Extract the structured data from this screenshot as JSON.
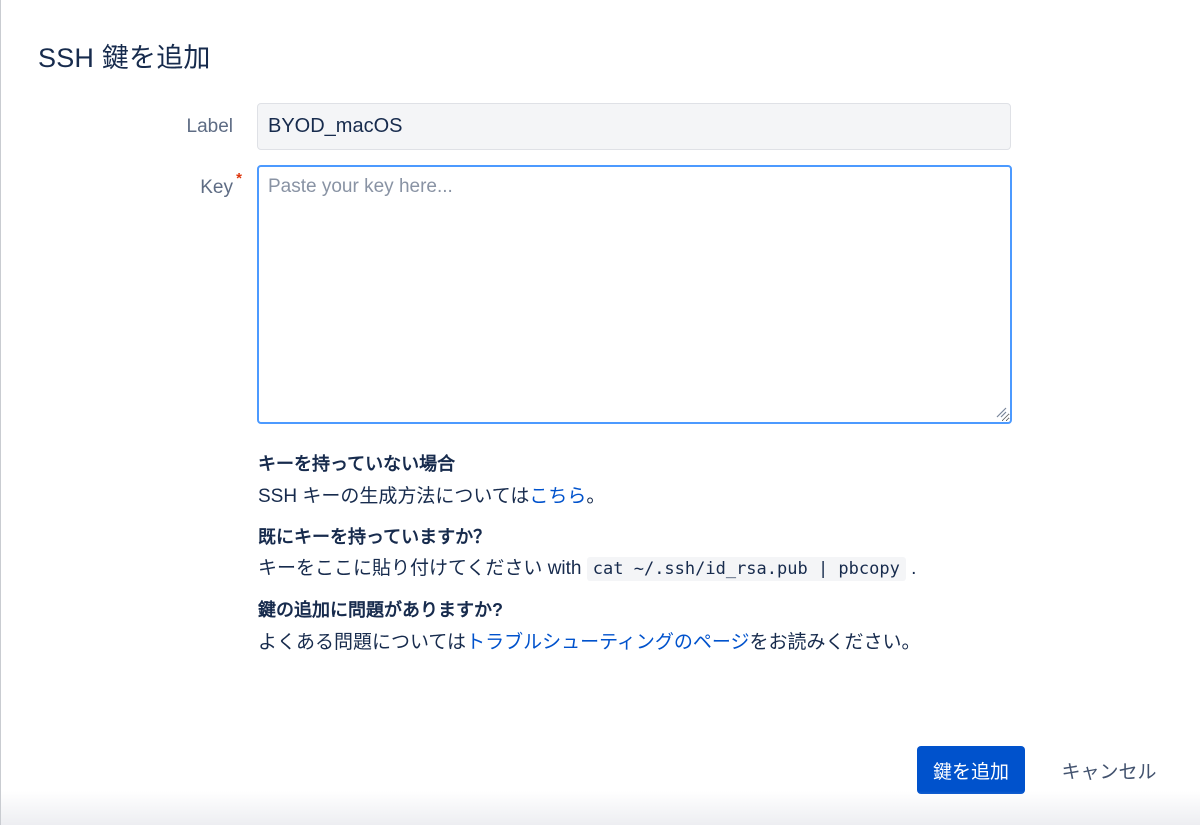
{
  "dialog": {
    "title": "SSH 鍵を追加"
  },
  "form": {
    "label_field": {
      "label": "Label",
      "value": "BYOD_macOS"
    },
    "key_field": {
      "label": "Key",
      "required_marker": "*",
      "placeholder": "Paste your key here...",
      "value": ""
    }
  },
  "help": {
    "no_key": {
      "heading": "キーを持っていない場合",
      "text_before": "SSH キーの生成方法については",
      "link": "こちら",
      "text_after": "。"
    },
    "have_key": {
      "heading": "既にキーを持っていますか？",
      "text_before": "キーをここに貼り付けてください with ",
      "command": "cat ~/.ssh/id_rsa.pub | pbcopy",
      "text_after": " ."
    },
    "problem": {
      "heading": "鍵の追加に問題がありますか?",
      "text_before": "よくある問題については",
      "link": "トラブルシューティングのページ",
      "text_after": "をお読みください。"
    }
  },
  "actions": {
    "submit_label": "鍵を追加",
    "cancel_label": "キャンセル"
  },
  "colors": {
    "primary": "#0052cc",
    "link": "#0052cc",
    "focus_border": "#4c9aff",
    "required": "#de350b",
    "text": "#172b4d"
  }
}
